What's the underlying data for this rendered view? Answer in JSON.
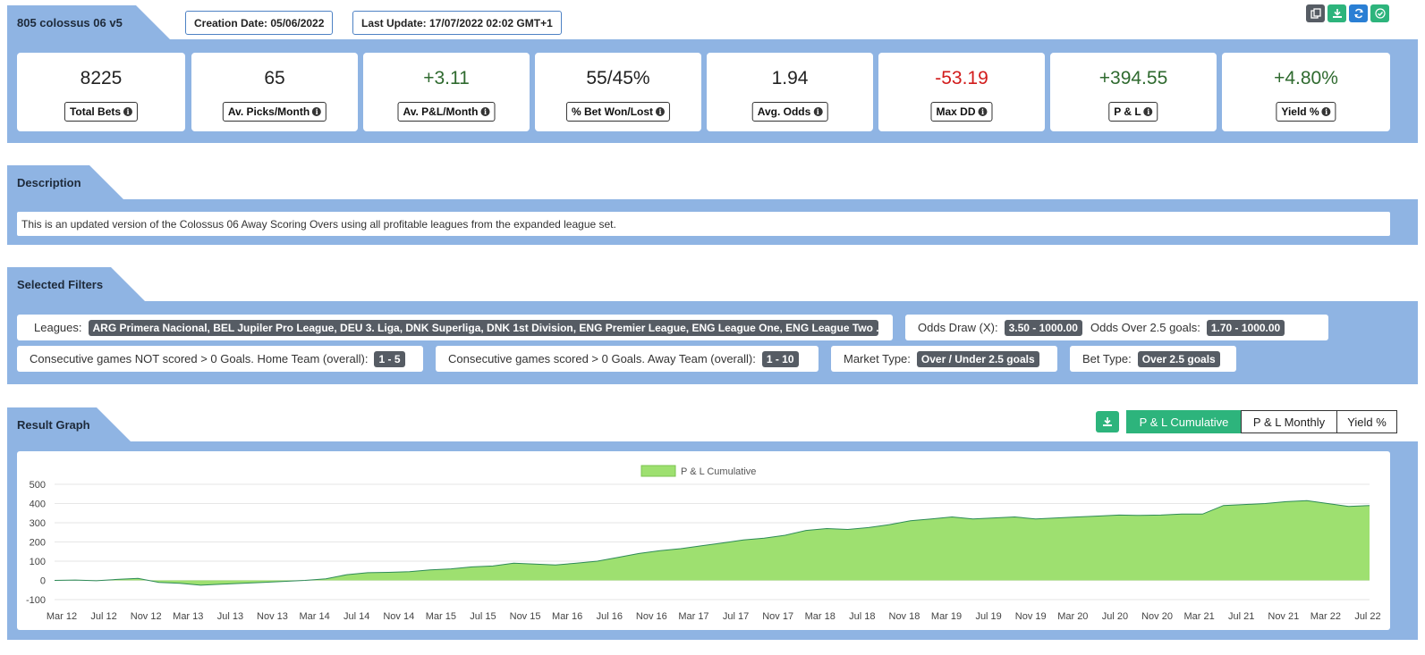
{
  "header": {
    "title": "805 colossus 06 v5",
    "creation_date": "Creation Date: 05/06/2022",
    "last_update": "Last Update: 17/07/2022 02:02 GMT+1",
    "tools": [
      {
        "icon": "copy-icon",
        "color": "#565c64"
      },
      {
        "icon": "download-icon",
        "color": "#2db47c"
      },
      {
        "icon": "refresh-icon",
        "color": "#2a7fd4"
      },
      {
        "icon": "save-check-icon",
        "color": "#2db47c"
      }
    ]
  },
  "stats": [
    {
      "value": "8225",
      "label": "Total Bets",
      "tone": "neutral"
    },
    {
      "value": "65",
      "label": "Av. Picks/Month",
      "tone": "neutral"
    },
    {
      "value": "+3.11",
      "label": "Av. P&L/Month",
      "tone": "pos"
    },
    {
      "value": "55/45%",
      "label": "% Bet Won/Lost",
      "tone": "neutral"
    },
    {
      "value": "1.94",
      "label": "Avg. Odds",
      "tone": "neutral"
    },
    {
      "value": "-53.19",
      "label": "Max DD",
      "tone": "neg"
    },
    {
      "value": "+394.55",
      "label": "P & L",
      "tone": "pos"
    },
    {
      "value": "+4.80%",
      "label": "Yield %",
      "tone": "pos"
    }
  ],
  "description": {
    "title": "Description",
    "text": "This is an updated version of the Colossus 06 Away Scoring Overs using all profitable leagues from the expanded league set."
  },
  "filters": {
    "title": "Selected Filters",
    "leagues_label": "Leagues:",
    "leagues_value": "ARG Primera Nacional, BEL Jupiler Pro League, DEU 3. Liga, DNK Superliga, DNK 1st Division, ENG Premier League, ENG League One, ENG League Two ...",
    "odds_draw_label": "Odds Draw (X):",
    "odds_draw_value": "3.50 - 1000.00",
    "odds_over_label": "Odds Over 2.5 goals:",
    "odds_over_value": "1.70 - 1000.00",
    "home_not_scored_label": "Consecutive games NOT scored > 0 Goals. Home Team (overall):",
    "home_not_scored_value": "1 - 5",
    "away_scored_label": "Consecutive games scored > 0 Goals. Away Team (overall):",
    "away_scored_value": "1 - 10",
    "market_label": "Market Type:",
    "market_value": "Over / Under 2.5 goals",
    "bet_label": "Bet Type:",
    "bet_value": "Over 2.5 goals"
  },
  "graph": {
    "title": "Result Graph",
    "tabs": [
      "P & L Cumulative",
      "P & L Monthly",
      "Yield %"
    ],
    "active_tab": 0,
    "download_icon": "download-icon"
  },
  "chart_data": {
    "type": "area",
    "legend": "P & L Cumulative",
    "legend_placement": "top-center",
    "fill_color": "#9ee070",
    "line_color": "#2e8b57",
    "ylim": [
      -100,
      500
    ],
    "yticks": [
      -100,
      0,
      100,
      200,
      300,
      400,
      500
    ],
    "grid": true,
    "xtick_labels": [
      "Mar 12",
      "Jul 12",
      "Nov 12",
      "Mar 13",
      "Jul 13",
      "Nov 13",
      "Mar 14",
      "Jul 14",
      "Nov 14",
      "Mar 15",
      "Jul 15",
      "Nov 15",
      "Mar 16",
      "Jul 16",
      "Nov 16",
      "Mar 17",
      "Jul 17",
      "Nov 17",
      "Mar 18",
      "Jul 18",
      "Nov 18",
      "Mar 19",
      "Jul 19",
      "Nov 19",
      "Mar 20",
      "Jul 20",
      "Nov 20",
      "Mar 21",
      "Jul 21",
      "Nov 21",
      "Mar 22",
      "Jul 22"
    ],
    "x": [
      "Mar 12",
      "May 12",
      "Jul 12",
      "Sep 12",
      "Oct 12",
      "Nov 12",
      "Jan 13",
      "Mar 13",
      "May 13",
      "Jul 13",
      "Sep 13",
      "Nov 13",
      "Jan 14",
      "Mar 14",
      "May 14",
      "Jul 14",
      "Sep 14",
      "Nov 14",
      "Jan 15",
      "Mar 15",
      "May 15",
      "Jul 15",
      "Sep 15",
      "Nov 15",
      "Jan 16",
      "Mar 16",
      "May 16",
      "Jul 16",
      "Sep 16",
      "Nov 16",
      "Jan 17",
      "Mar 17",
      "May 17",
      "Jul 17",
      "Sep 17",
      "Nov 17",
      "Jan 18",
      "Mar 18",
      "May 18",
      "Jul 18",
      "Sep 18",
      "Nov 18",
      "Jan 19",
      "Mar 19",
      "May 19",
      "Jul 19",
      "Sep 19",
      "Nov 19",
      "Jan 20",
      "Mar 20",
      "May 20",
      "Jul 20",
      "Sep 20",
      "Nov 20",
      "Jan 21",
      "Mar 21",
      "May 21",
      "Jul 21",
      "Sep 21",
      "Nov 21",
      "Jan 22",
      "Mar 22",
      "May 22",
      "Jul 22"
    ],
    "values": [
      0,
      2,
      -2,
      5,
      10,
      -10,
      -15,
      -25,
      -20,
      -15,
      -10,
      -5,
      0,
      8,
      30,
      40,
      42,
      45,
      55,
      60,
      70,
      75,
      90,
      85,
      80,
      90,
      100,
      120,
      140,
      155,
      165,
      180,
      195,
      210,
      220,
      235,
      260,
      270,
      265,
      275,
      290,
      310,
      320,
      330,
      320,
      325,
      330,
      320,
      325,
      330,
      335,
      340,
      338,
      340,
      345,
      345,
      390,
      395,
      400,
      410,
      415,
      400,
      385,
      390
    ]
  }
}
